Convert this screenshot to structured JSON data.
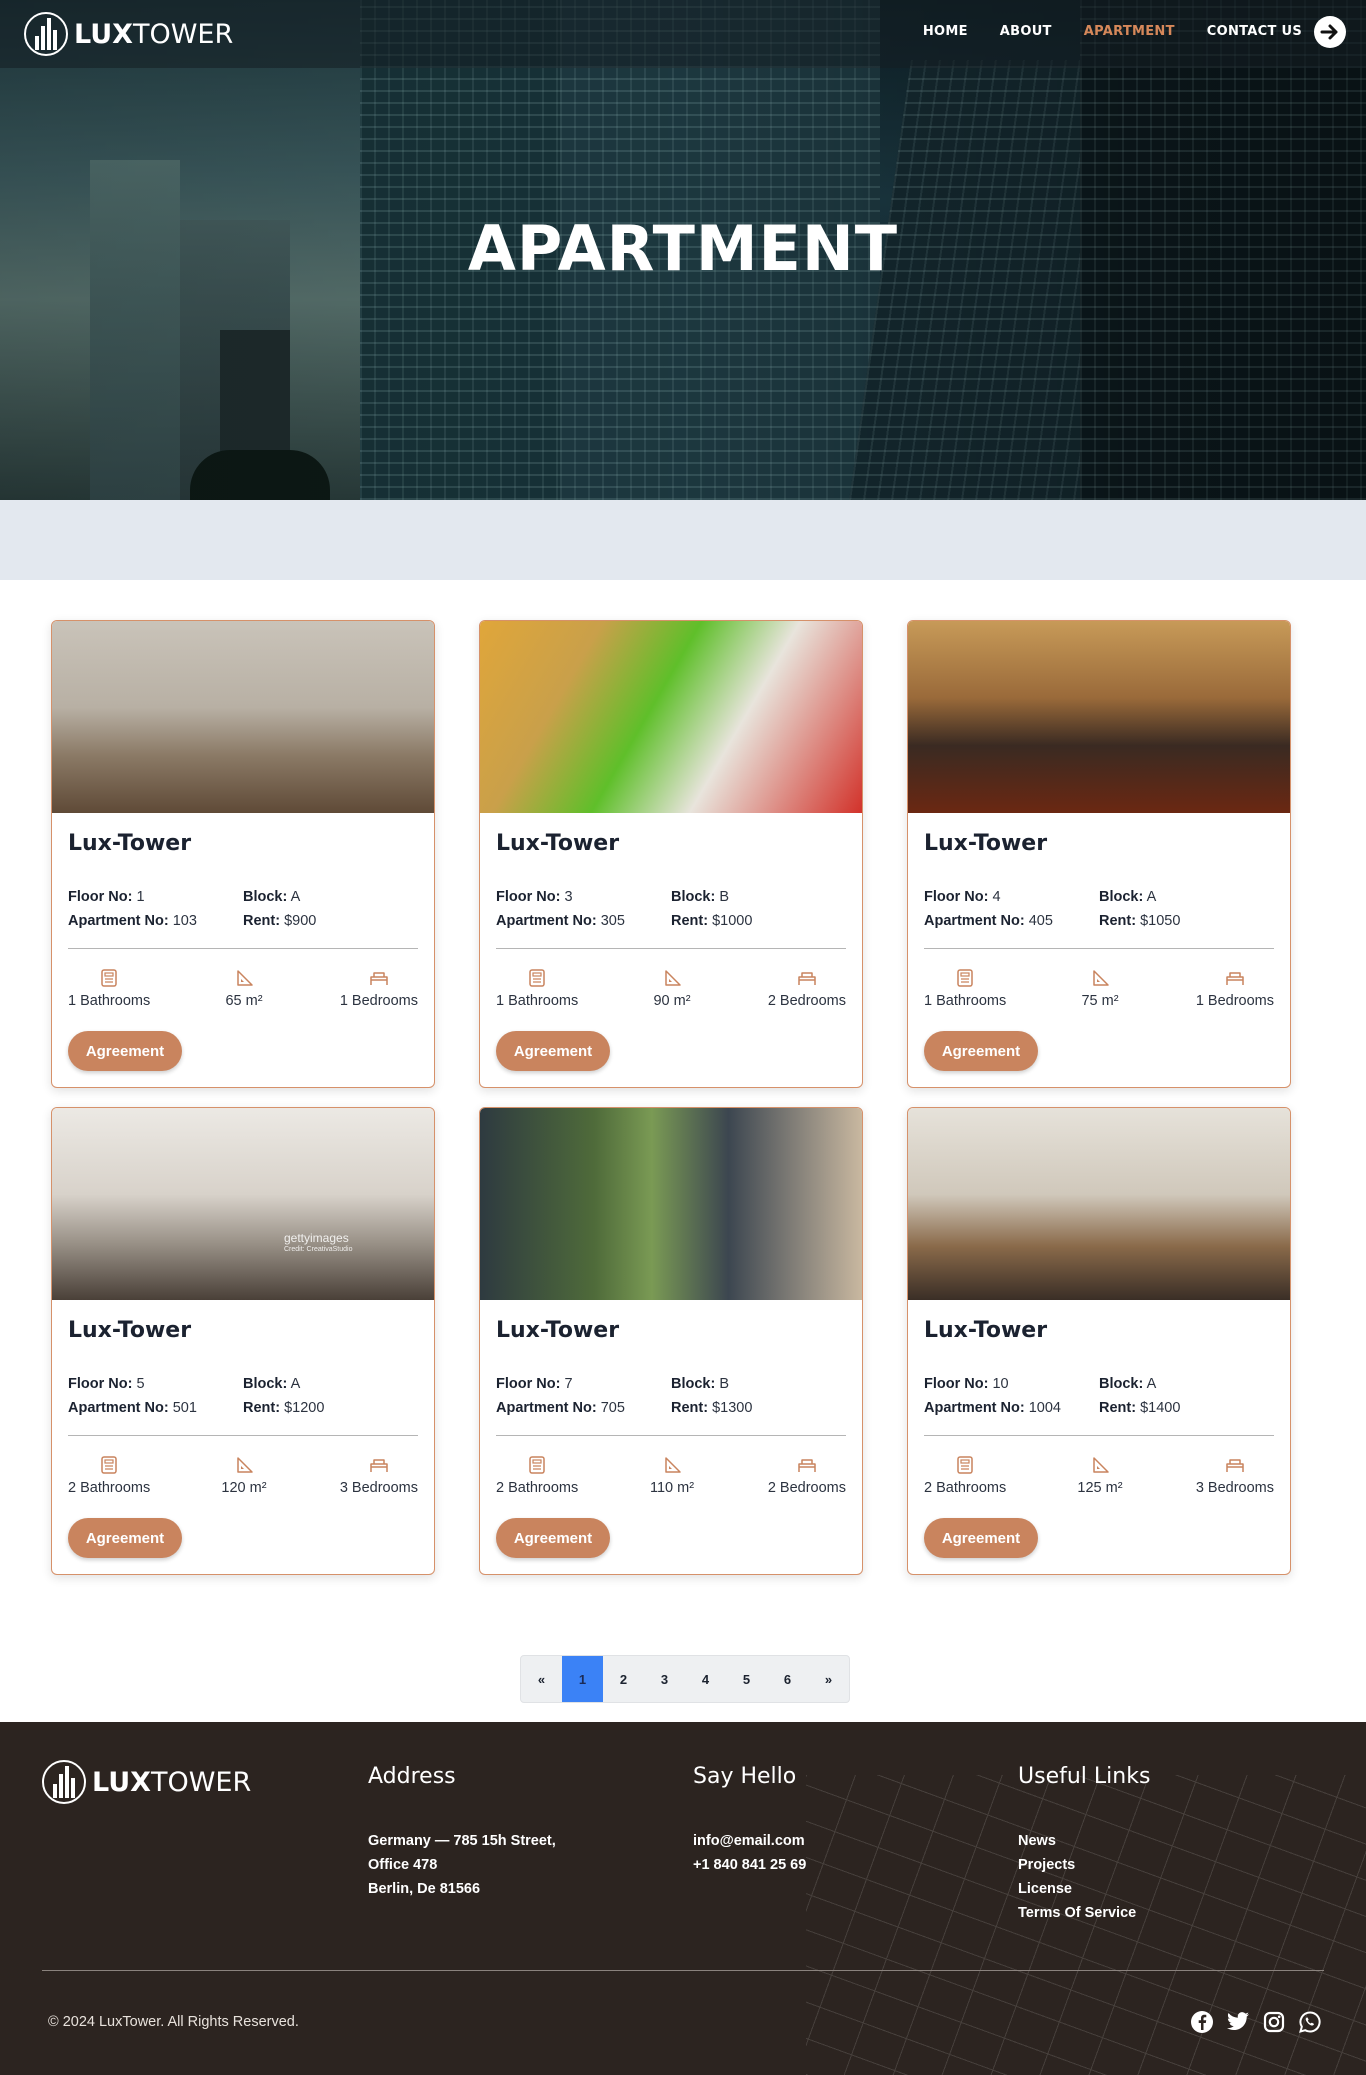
{
  "brand": {
    "bold": "LUX",
    "light": "TOWER"
  },
  "nav": {
    "items": [
      {
        "label": "HOME",
        "active": false
      },
      {
        "label": "ABOUT",
        "active": false
      },
      {
        "label": "APARTMENT",
        "active": true
      },
      {
        "label": "CONTACT US",
        "active": false
      }
    ],
    "login_icon": "arrow-right-circle-icon"
  },
  "hero": {
    "title": "APARTMENT"
  },
  "labels": {
    "floor": "Floor No:",
    "block": "Block:",
    "apartment": "Apartment No:",
    "rent": "Rent:",
    "button": "Agreement"
  },
  "apartments": [
    {
      "name": "Lux-Tower",
      "floor": "1",
      "block": "A",
      "apartment_no": "103",
      "rent": "$900",
      "bathrooms": "1 Bathrooms",
      "area": "65 m²",
      "bedrooms": "1 Bedrooms"
    },
    {
      "name": "Lux-Tower",
      "floor": "3",
      "block": "B",
      "apartment_no": "305",
      "rent": "$1000",
      "bathrooms": "1 Bathrooms",
      "area": "90 m²",
      "bedrooms": "2 Bedrooms"
    },
    {
      "name": "Lux-Tower",
      "floor": "4",
      "block": "A",
      "apartment_no": "405",
      "rent": "$1050",
      "bathrooms": "1 Bathrooms",
      "area": "75 m²",
      "bedrooms": "1 Bedrooms"
    },
    {
      "name": "Lux-Tower",
      "floor": "5",
      "block": "A",
      "apartment_no": "501",
      "rent": "$1200",
      "bathrooms": "2 Bathrooms",
      "area": "120 m²",
      "bedrooms": "3 Bedrooms"
    },
    {
      "name": "Lux-Tower",
      "floor": "7",
      "block": "B",
      "apartment_no": "705",
      "rent": "$1300",
      "bathrooms": "2 Bathrooms",
      "area": "110 m²",
      "bedrooms": "2 Bedrooms"
    },
    {
      "name": "Lux-Tower",
      "floor": "10",
      "block": "A",
      "apartment_no": "1004",
      "rent": "$1400",
      "bathrooms": "2 Bathrooms",
      "area": "125 m²",
      "bedrooms": "3 Bedrooms"
    }
  ],
  "photo_watermark": {
    "main": "gettyimages",
    "sub": "Credit: CreativaStudio"
  },
  "pagination": {
    "prev": "«",
    "pages": [
      "1",
      "2",
      "3",
      "4",
      "5",
      "6"
    ],
    "current": "1",
    "next": "»"
  },
  "footer": {
    "address": {
      "heading": "Address",
      "lines": [
        "Germany — 785 15h Street,",
        "Office 478",
        "Berlin, De 81566"
      ]
    },
    "say_hello": {
      "heading": "Say Hello",
      "lines": [
        "info@email.com",
        "+1 840 841 25 69"
      ]
    },
    "useful_links": {
      "heading": "Useful Links",
      "links": [
        "News",
        "Projects",
        "License",
        "Terms Of Service"
      ]
    },
    "copyright": "© 2024 LuxTower. All Rights Reserved.",
    "social": [
      "facebook-icon",
      "twitter-icon",
      "instagram-icon",
      "whatsapp-icon"
    ]
  },
  "colors": {
    "accent": "#c9845e",
    "nav_active": "#d6885a",
    "footer_bg": "#2c2420",
    "pager_current": "#3b82f6"
  }
}
